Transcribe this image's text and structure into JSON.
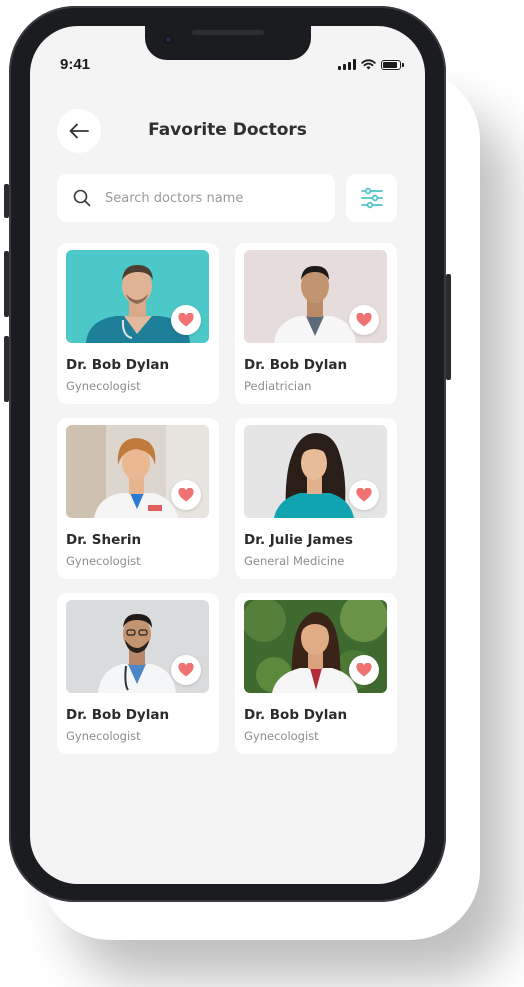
{
  "status_bar": {
    "time": "9:41"
  },
  "header": {
    "title": "Favorite Doctors"
  },
  "search": {
    "placeholder": "Search doctors name"
  },
  "colors": {
    "accent": "#4cc3c9",
    "heart": "#f07272",
    "screen_bg": "#f4f4f4",
    "card_bg": "#ffffff"
  },
  "doctors": [
    {
      "name": "Dr. Bob Dylan",
      "specialty": "Gynecologist",
      "favorite": true
    },
    {
      "name": "Dr. Bob Dylan",
      "specialty": "Pediatrician",
      "favorite": true
    },
    {
      "name": "Dr. Sherin",
      "specialty": "Gynecologist",
      "favorite": true
    },
    {
      "name": "Dr. Julie James",
      "specialty": "General Medicine",
      "favorite": true
    },
    {
      "name": "Dr. Bob Dylan",
      "specialty": "Gynecologist",
      "favorite": true
    },
    {
      "name": "Dr. Bob Dylan",
      "specialty": "Gynecologist",
      "favorite": true
    }
  ],
  "icons": {
    "back": "arrow-left-icon",
    "search": "search-icon",
    "filter": "sliders-icon",
    "favorite": "heart-icon"
  }
}
